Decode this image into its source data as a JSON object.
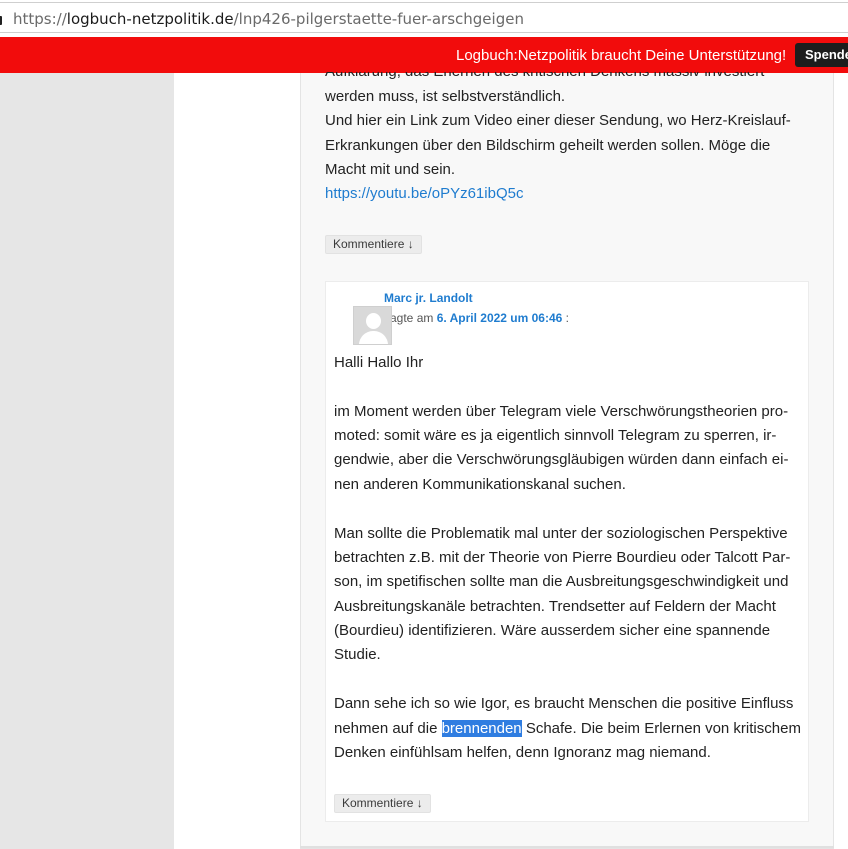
{
  "browser": {
    "url_scheme": "https://",
    "url_host": "logbuch-netzpolitik.de",
    "url_path": "/lnp426-pilgerstaette-fuer-arschgeigen"
  },
  "banner": {
    "message": "Logbuch:Netzpolitik braucht Deine Unterstützung!",
    "donate_label": "Spende",
    "color": "#f20c0c"
  },
  "parent_comment": {
    "lines": [
      "Aufklärung, das Erlernen des kritischen Denkens massiv investiert",
      "werden muss, ist selbstverständlich.",
      "Und hier ein Link zum Video einer dieser Sendung, wo Herz-Kreislauf-",
      "Erkrankungen über den Bildschirm geheilt werden sollen. Möge die",
      "Macht mit und sein."
    ],
    "link": "https://youtu.be/oPYz61ibQ5c",
    "reply_label": "Kommentiere ↓"
  },
  "reply": {
    "author": "Marc jr. Landolt",
    "said_prefix": "sagte am",
    "date": "6. April 2022 um 06:46",
    "said_suffix": ":",
    "greeting": "Halli Hallo Ihr",
    "para1": [
      "im Moment werden über Telegram viele Verschwörungstheorien pro-",
      "moted: somit wäre es ja eigentlich sinnvoll Telegram zu sperren, ir-",
      "gendwie, aber die Verschwörungsgläubigen würden dann einfach ei-",
      "nen anderen Kommunikationskanal suchen."
    ],
    "para2": [
      "Man sollte die Problematik mal unter der soziologischen Perspektive",
      "betrachten z.B. mit der Theorie von Pierre Bourdieu oder Talcott Par-",
      "son, im spetifischen sollte man die Ausbreitungsgeschwindigkeit und",
      "Ausbreitungskanäle betrachten. Trendsetter auf Feldern der Macht",
      "(Bourdieu) identifizieren. Wäre ausserdem sicher eine spannende",
      "Studie."
    ],
    "para3_line1": "Dann sehe ich so wie Igor, es braucht Menschen die positive Einfluss",
    "para3_line2_before": "nehmen auf die ",
    "para3_selected": "brennenden",
    "para3_line2_after": " Schafe. Die beim Erlernen von kritischem",
    "para3_line3": "Denken einfühlsam helfen, denn Ignoranz mag niemand.",
    "reply_label": "Kommentiere ↓"
  }
}
